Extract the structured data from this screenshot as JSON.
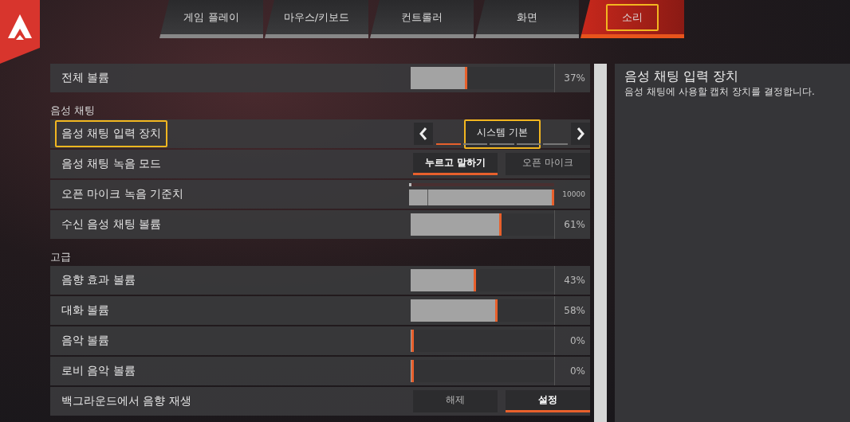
{
  "tabs": [
    {
      "label": "게임 플레이",
      "selected": false
    },
    {
      "label": "마우스/키보드",
      "selected": false
    },
    {
      "label": "컨트롤러",
      "selected": false
    },
    {
      "label": "화면",
      "selected": false
    },
    {
      "label": "소리",
      "selected": true
    }
  ],
  "settings": [
    {
      "kind": "slider",
      "label": "전체 볼륨",
      "level": 0.37,
      "reading": "37%",
      "focused": false
    },
    {
      "kind": "header",
      "label": "음성 채팅"
    },
    {
      "kind": "selector",
      "label": "음성 채팅 입력 장치",
      "value": "시스템 기본",
      "focused": true,
      "segments": [
        {
          "selected": true
        },
        {
          "selected": false
        },
        {
          "selected": false
        },
        {
          "selected": false
        },
        {
          "selected": false
        }
      ]
    },
    {
      "kind": "toggle",
      "label": "음성 채팅 녹음 모드",
      "focused": false,
      "options": [
        {
          "label": "누르고 말하기",
          "selected": true
        },
        {
          "label": "오픈 마이크",
          "selected": false
        }
      ]
    },
    {
      "kind": "threshold",
      "label": "오픈 마이크 녹음 기준치",
      "level": 1,
      "reading": "10000",
      "focused": false
    },
    {
      "kind": "slider",
      "label": "수신 음성 채팅 볼륨",
      "level": 0.61,
      "reading": "61%",
      "focused": false
    },
    {
      "kind": "header",
      "label": "고급"
    },
    {
      "kind": "slider",
      "label": "음향 효과 볼륨",
      "level": 0.43,
      "reading": "43%",
      "focused": false
    },
    {
      "kind": "slider",
      "label": "대화 볼륨",
      "level": 0.58,
      "reading": "58%",
      "focused": false
    },
    {
      "kind": "slider",
      "label": "음악 볼륨",
      "level": 0,
      "reading": "0%",
      "focused": false
    },
    {
      "kind": "slider",
      "label": "로비 음악 볼륨",
      "level": 0,
      "reading": "0%",
      "focused": false
    },
    {
      "kind": "toggle",
      "label": "백그라운드에서 음향 재생",
      "focused": false,
      "options": [
        {
          "label": "해제",
          "selected": false
        },
        {
          "label": "설정",
          "selected": true
        }
      ]
    }
  ],
  "detail": {
    "title": "음성 채팅 입력 장치",
    "description": "음성 채팅에 사용할 캡처 장치를 결정합니다."
  }
}
